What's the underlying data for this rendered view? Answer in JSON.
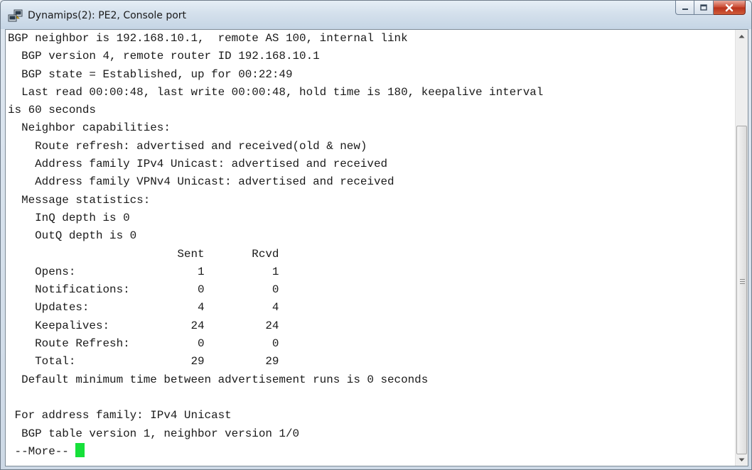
{
  "window": {
    "title": "Dynamips(2): PE2, Console port",
    "icon": "putty-terminal-icon"
  },
  "console": {
    "lines": [
      "BGP neighbor is 192.168.10.1,  remote AS 100, internal link",
      "  BGP version 4, remote router ID 192.168.10.1",
      "  BGP state = Established, up for 00:22:49",
      "  Last read 00:00:48, last write 00:00:48, hold time is 180, keepalive interval",
      "is 60 seconds",
      "  Neighbor capabilities:",
      "    Route refresh: advertised and received(old & new)",
      "    Address family IPv4 Unicast: advertised and received",
      "    Address family VPNv4 Unicast: advertised and received",
      "  Message statistics:",
      "    InQ depth is 0",
      "    OutQ depth is 0",
      "                         Sent       Rcvd",
      "    Opens:                  1          1",
      "    Notifications:          0          0",
      "    Updates:                4          4",
      "    Keepalives:            24         24",
      "    Route Refresh:          0          0",
      "    Total:                 29         29",
      "  Default minimum time between advertisement runs is 0 seconds",
      "",
      " For address family: IPv4 Unicast",
      "  BGP table version 1, neighbor version 1/0"
    ],
    "prompt": " --More-- ",
    "cursor_color": "#16e03a"
  },
  "colors": {
    "titlebar": "#d4e0ec",
    "close_button": "#c9472f",
    "background": "#ffffff",
    "text": "#1a1a1a"
  }
}
